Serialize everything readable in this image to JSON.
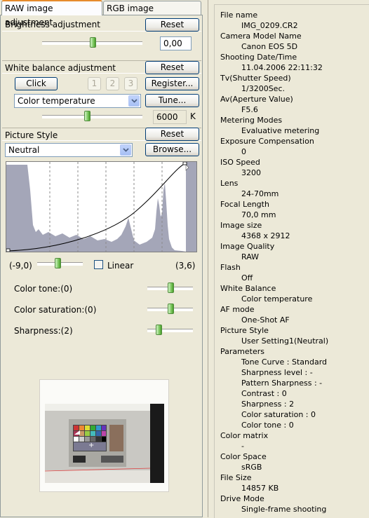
{
  "tabs": [
    {
      "label": "RAW image adjustment",
      "active": true
    },
    {
      "label": "RGB image adjustment",
      "active": false
    }
  ],
  "brightness": {
    "title": "Brightness adjustment",
    "reset_label": "Reset",
    "value": "0,00",
    "level": 0.5
  },
  "white_balance": {
    "title": "White balance adjustment",
    "reset_label": "Reset",
    "click_label": "Click",
    "presets": [
      "1",
      "2",
      "3"
    ],
    "register_label": "Register...",
    "mode": "Color temperature",
    "tune_label": "Tune...",
    "temperature": "6000",
    "unit": "K",
    "level": 0.45
  },
  "picture_style": {
    "title": "Picture Style",
    "reset_label": "Reset",
    "style": "Neutral",
    "browse_label": "Browse...",
    "range_min": "(-9,0)",
    "range_max": "(3,6)",
    "linear_label": "Linear",
    "linear_checked": false,
    "curve_level": 0.45,
    "tone_label": "Color tone:(0)",
    "saturation_label": "Color saturation:(0)",
    "sharpness_label": "Sharpness:(2)",
    "tone_level": 0.5,
    "saturation_level": 0.5,
    "sharpness_level": 0.25
  },
  "colors": {
    "panel_bg": "#ece9d8",
    "histogram_fill": "#a4a6b8",
    "tab_accent": "#e68b2c",
    "thumb_green": "#7cc65e"
  },
  "info": [
    {
      "label": "File name",
      "value": "IMG_0209.CR2"
    },
    {
      "label": "Camera Model Name",
      "value": "Canon EOS 5D"
    },
    {
      "label": "Shooting Date/Time",
      "value": "11.04.2006 22:11:32"
    },
    {
      "label": "Tv(Shutter Speed)",
      "value": "1/3200Sec."
    },
    {
      "label": "Av(Aperture Value)",
      "value": "F5.6"
    },
    {
      "label": "Metering Modes",
      "value": "Evaluative metering"
    },
    {
      "label": "Exposure Compensation",
      "value": "0"
    },
    {
      "label": "ISO Speed",
      "value": "3200"
    },
    {
      "label": "Lens",
      "value": "24-70mm"
    },
    {
      "label": "Focal Length",
      "value": "70,0 mm"
    },
    {
      "label": "Image size",
      "value": "4368 x 2912"
    },
    {
      "label": "Image Quality",
      "value": "RAW"
    },
    {
      "label": "Flash",
      "value": "Off"
    },
    {
      "label": "White Balance",
      "value": "Color temperature"
    },
    {
      "label": "AF mode",
      "value": "One-Shot AF"
    },
    {
      "label": "Picture Style",
      "value": "User Setting1(Neutral)"
    }
  ],
  "parameters": {
    "label": "Parameters",
    "items": [
      "Tone Curve :   Standard",
      "Sharpness level :   -",
      "Pattern Sharpness :   -",
      "Contrast :   0",
      "Sharpness :   2",
      "Color saturation :   0",
      "Color tone :   0"
    ]
  },
  "info_tail": [
    {
      "label": "Color matrix",
      "value": "-"
    },
    {
      "label": "Color Space",
      "value": "sRGB"
    },
    {
      "label": "File Size",
      "value": "14857 KB"
    },
    {
      "label": "Drive Mode",
      "value": "Single-frame shooting"
    }
  ]
}
